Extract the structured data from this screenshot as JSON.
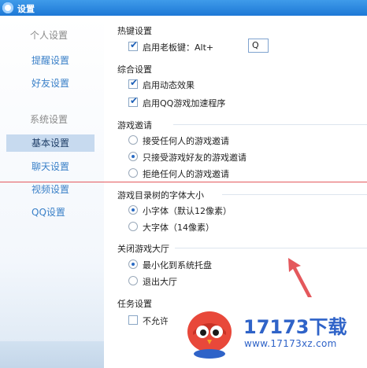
{
  "window": {
    "title": "设置"
  },
  "sidebar": {
    "groups": [
      {
        "label": "个人设置",
        "items": [
          "提醒设置",
          "好友设置"
        ]
      },
      {
        "label": "系统设置",
        "items": [
          "基本设置",
          "聊天设置",
          "视频设置",
          "QQ设置"
        ]
      }
    ],
    "selected": "基本设置"
  },
  "hotkey": {
    "title": "热键设置",
    "boss_key_label": "启用老板键：Alt+",
    "boss_key_checked": true,
    "boss_key_value": "Q"
  },
  "general": {
    "title": "综合设置",
    "options": [
      {
        "label": "启用动态效果",
        "checked": true
      },
      {
        "label": "启用QQ游戏加速程序",
        "checked": true
      }
    ]
  },
  "invite": {
    "title": "游戏邀请",
    "options": [
      {
        "label": "接受任何人的游戏邀请",
        "selected": false
      },
      {
        "label": "只接受游戏好友的游戏邀请",
        "selected": true
      },
      {
        "label": "拒绝任何人的游戏邀请",
        "selected": false
      }
    ]
  },
  "font_size": {
    "title": "游戏目录树的字体大小",
    "options": [
      {
        "label": "小字体（默认12像素）",
        "selected": true
      },
      {
        "label": "大字体（14像素）",
        "selected": false
      }
    ]
  },
  "close_lobby": {
    "title": "关闭游戏大厅",
    "options": [
      {
        "label": "最小化到系统托盘",
        "selected": true
      },
      {
        "label": "退出大厅",
        "selected": false
      }
    ]
  },
  "task": {
    "title": "任务设置",
    "partial_option": "不允许"
  },
  "watermark": {
    "brand": "17173下载",
    "url": "www.17173xz.com"
  },
  "colors": {
    "titlebar": "#1d78d6",
    "link": "#3a80c8",
    "selected_bg": "#c7daef",
    "annotation_red": "#e4585c",
    "brand_blue": "#2f63c8"
  }
}
